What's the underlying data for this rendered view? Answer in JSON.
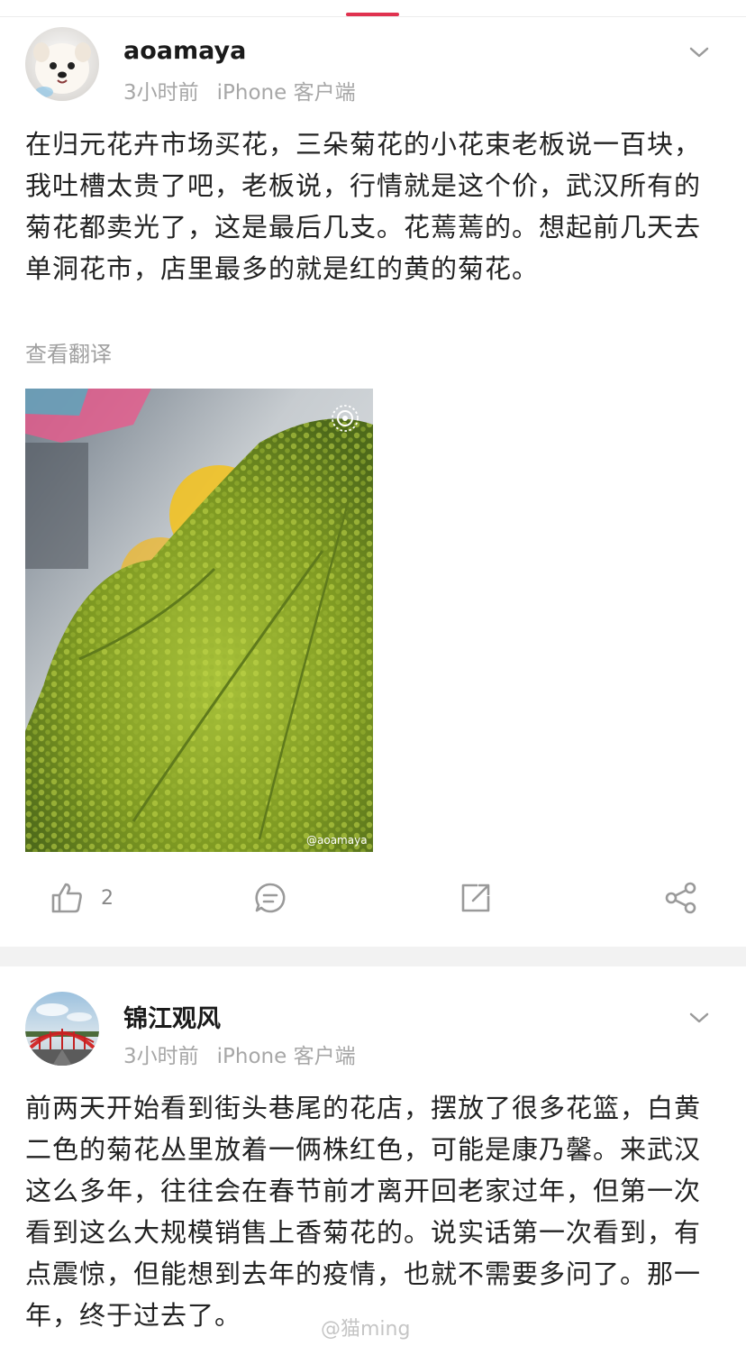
{
  "posts": [
    {
      "username": "aoamaya",
      "time": "3小时前",
      "source": "iPhone 客户端",
      "body": "在归元花卉市场买花，三朵菊花的小花束老板说一百块，我吐槽太贵了吧，老板说，行情就是这个价，武汉所有的菊花都卖光了，这是最后几支。花蔫蔫的。想起前几天去单洞花市，店里最多的就是红的黄的菊花。",
      "translate_label": "查看翻译",
      "image_watermark": "@aoamaya",
      "likes": "2"
    },
    {
      "username": "锦江观风",
      "time": "3小时前",
      "source": "iPhone 客户端",
      "body": "前两天开始看到街头巷尾的花店，摆放了很多花篮，白黄二色的菊花丛里放着一俩株红色，可能是康乃馨。来武汉这么多年，往往会在春节前才离开回老家过年，但第一次看到这么大规模销售上香菊花的。说实话第一次看到，有点震惊，但能想到去年的疫情，也就不需要多问了。那一年，终于过去了。"
    }
  ],
  "page_watermark": "@猫ming",
  "colors": {
    "accent": "#e0324f",
    "meta_text": "#a7a7a7",
    "icon": "#9a9a9a"
  },
  "icons": [
    "chevron-down-icon",
    "live-photo-icon",
    "thumbs-up-icon",
    "comment-icon",
    "repost-icon",
    "share-icon"
  ]
}
